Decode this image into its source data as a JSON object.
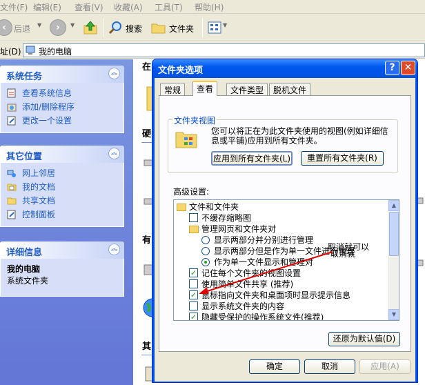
{
  "menubar": {
    "items": [
      "文件(F)",
      "编辑(E)",
      "查看(V)",
      "收藏(A)",
      "工具(T)",
      "帮助(H)"
    ]
  },
  "toolbar": {
    "back": "后退",
    "search": "搜索",
    "folders": "文件夹"
  },
  "address": {
    "label": "址(D)",
    "value": "我的电脑"
  },
  "left_pane": {
    "system_tasks": {
      "title": "系统任务",
      "items": [
        "查看系统信息",
        "添加/删除程序",
        "更改一个设置"
      ]
    },
    "other_places": {
      "title": "其它位置",
      "items": [
        "网上邻居",
        "我的文档",
        "共享文档",
        "控制面板"
      ]
    },
    "details": {
      "title": "详细信息",
      "name": "我的电脑",
      "type": "系统文件夹"
    }
  },
  "right_area": {
    "sections": [
      "在",
      "硬",
      "有",
      "其"
    ]
  },
  "dialog": {
    "title": "文件夹选项",
    "tabs": [
      "常规",
      "查看",
      "文件类型",
      "脱机文件"
    ],
    "active_tab": "查看",
    "folder_views": {
      "label": "文件夹视图",
      "description": "您可以将正在为此文件夹使用的视图(例如详细信息或平铺)应用到所有文件夹。",
      "apply_all": "应用到所有文件夹(L)",
      "reset_all": "重置所有文件夹(R)"
    },
    "advanced_label": "高级设置:",
    "tree": [
      {
        "type": "folder",
        "level": 0,
        "label": "文件和文件夹"
      },
      {
        "type": "checkbox",
        "level": 1,
        "label": "不缓存缩略图",
        "checked": false
      },
      {
        "type": "folder",
        "level": 1,
        "label": "管理网页和文件夹对"
      },
      {
        "type": "radio",
        "level": 2,
        "label": "显示两部分并分别进行管理",
        "checked": false
      },
      {
        "type": "radio",
        "level": 2,
        "label": "显示两部分但是作为单一文件进行管理",
        "checked": false
      },
      {
        "type": "radio",
        "level": 2,
        "label": "作为单一文件显示和管理对",
        "checked": true
      },
      {
        "type": "checkbox",
        "level": 1,
        "label": "记住每个文件夹的视图设置",
        "checked": true
      },
      {
        "type": "checkbox",
        "level": 1,
        "label": "使用简单文件共享 (推荐)",
        "checked": false
      },
      {
        "type": "checkbox",
        "level": 1,
        "label": "鼠标指向文件夹和桌面项时显示提示信息",
        "checked": true
      },
      {
        "type": "checkbox",
        "level": 1,
        "label": "显示系统文件夹的内容",
        "checked": false
      },
      {
        "type": "checkbox",
        "level": 1,
        "label": "隐藏受保护的操作系统文件(推荐)",
        "checked": true
      }
    ],
    "restore_defaults": "还原为默认值(D)",
    "ok": "确定",
    "cancel": "取消",
    "apply": "应用(A)"
  },
  "annotation": {
    "line1": "取消就可以",
    "line2": "取消就"
  },
  "colors": {
    "title_blue": "#0054e3",
    "panel_link": "#215dc6",
    "check_green": "#21a121",
    "annotation_red": "#e00000"
  }
}
